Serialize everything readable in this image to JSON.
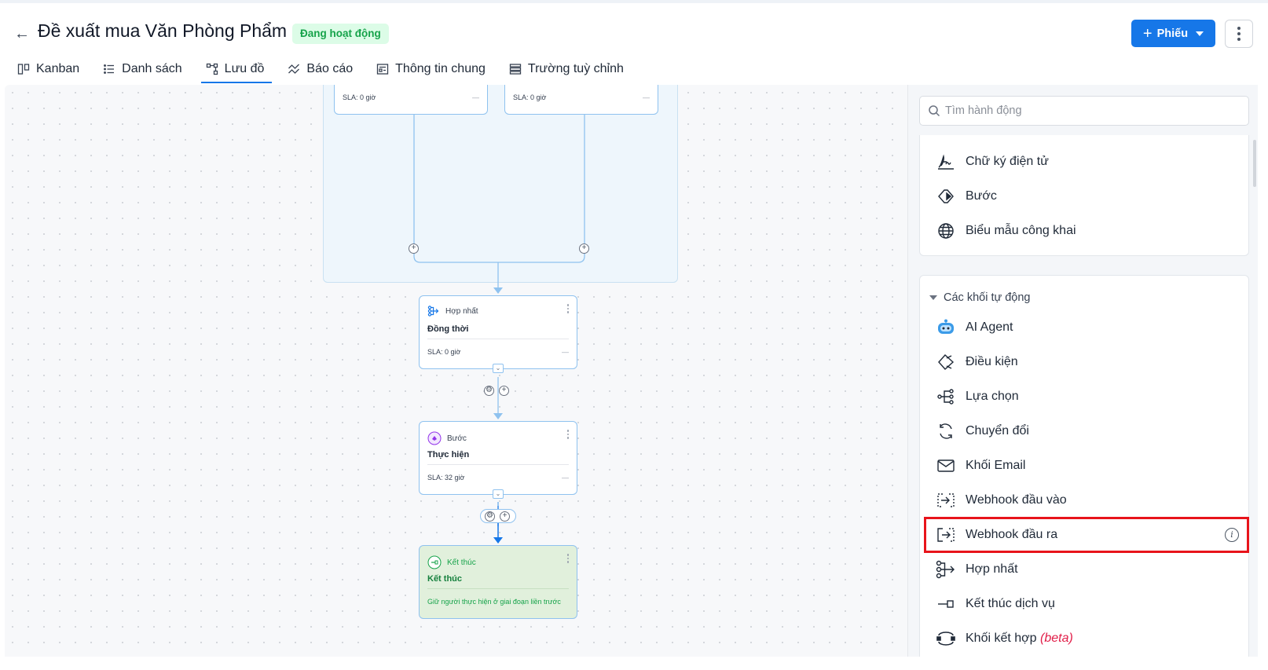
{
  "header": {
    "back_label": "←",
    "title": "Đề xuất mua Văn Phòng Phẩm",
    "status": "Đang hoạt động",
    "primary_button": "Phiếu",
    "primary_plus": "+"
  },
  "tabs": [
    {
      "label": "Kanban",
      "icon": "kanban-icon"
    },
    {
      "label": "Danh sách",
      "icon": "list-icon"
    },
    {
      "label": "Lưu đồ",
      "icon": "flowchart-icon",
      "active": true
    },
    {
      "label": "Báo cáo",
      "icon": "report-icon"
    },
    {
      "label": "Thông tin chung",
      "icon": "info-panel-icon"
    },
    {
      "label": "Trường tuỳ chỉnh",
      "icon": "custom-field-icon"
    }
  ],
  "flow": {
    "branch_left": {
      "sla": "SLA: 0 giờ",
      "dash": "—"
    },
    "branch_right": {
      "sla": "SLA: 0 giờ",
      "dash": "—"
    },
    "merge_node": {
      "type": "Hợp nhất",
      "title": "Đồng thời",
      "sla": "SLA: 0 giờ",
      "dash": "—"
    },
    "step_node": {
      "type": "Bước",
      "title": "Thực hiện",
      "sla": "SLA: 32 giờ",
      "dash": "—"
    },
    "end_node": {
      "type": "Kết thúc",
      "title": "Kết thúc",
      "note": "Giữ người thực hiện ở giai đoạn liền trước"
    }
  },
  "panel": {
    "search_placeholder": "Tìm hành động",
    "top_items": [
      {
        "label": "Chữ ký điện tử",
        "icon": "signature-icon"
      },
      {
        "label": "Bước",
        "icon": "step-icon"
      },
      {
        "label": "Biểu mẫu công khai",
        "icon": "globe-icon"
      }
    ],
    "auto_section_title": "Các khối tự động",
    "auto_items": [
      {
        "label": "AI Agent",
        "icon": "ai-agent-icon"
      },
      {
        "label": "Điều kiện",
        "icon": "condition-icon"
      },
      {
        "label": "Lựa chọn",
        "icon": "choice-icon"
      },
      {
        "label": "Chuyển đổi",
        "icon": "convert-icon"
      },
      {
        "label": "Khối Email",
        "icon": "email-icon"
      },
      {
        "label": "Webhook đầu vào",
        "icon": "webhook-in-icon"
      },
      {
        "label": "Webhook đầu ra",
        "icon": "webhook-out-icon",
        "highlighted": true,
        "info": "i"
      },
      {
        "label": "Hợp nhất",
        "icon": "merge-icon"
      },
      {
        "label": "Kết thúc dịch vụ",
        "icon": "end-service-icon"
      },
      {
        "label": "Khối kết hợp",
        "icon": "combine-icon",
        "suffix": "(beta)"
      }
    ]
  },
  "colors": {
    "accent": "#1677e8",
    "status_bg": "#dcfce7",
    "status_text": "#16a34a",
    "highlight": "#e8141b"
  }
}
